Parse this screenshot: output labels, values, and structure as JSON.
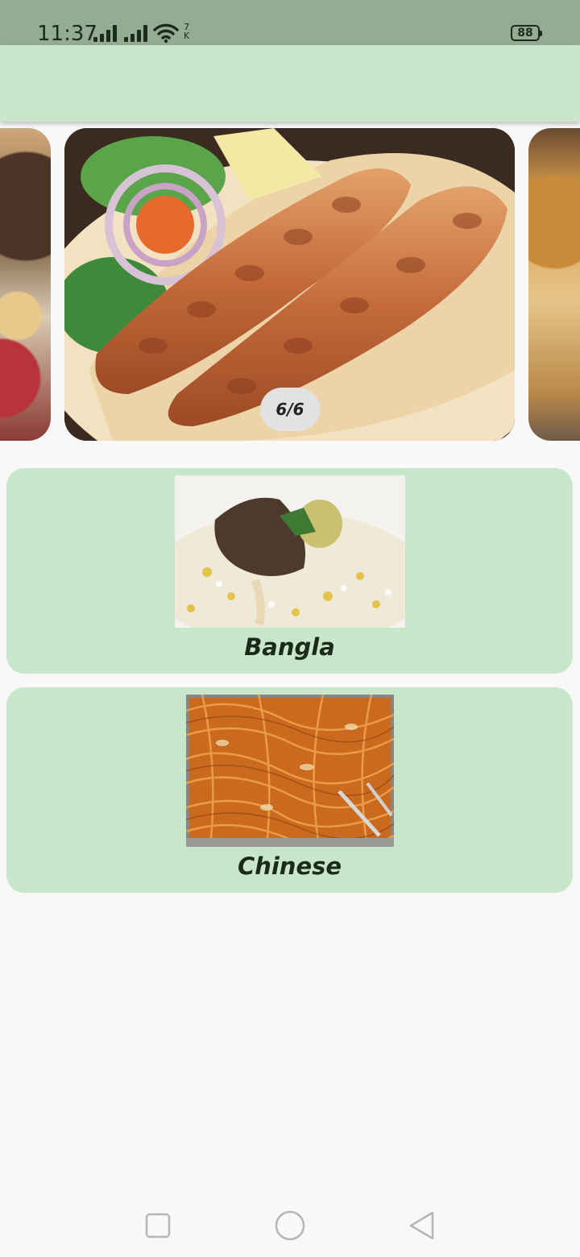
{
  "status_bar": {
    "time": "11:37",
    "net_speed_value": "7",
    "net_speed_unit": "K",
    "battery": "88"
  },
  "carousel": {
    "page_indicator": "6/6",
    "slides": [
      {
        "subject": "meat curry with salad"
      },
      {
        "subject": "seekh kebab on naan"
      },
      {
        "subject": "biryani"
      }
    ]
  },
  "categories": [
    {
      "title": "Bangla",
      "image_subject": "mutton biryani"
    },
    {
      "title": "Chinese",
      "image_subject": "chow mein noodles"
    }
  ],
  "navigation": {
    "recents": "recents-icon",
    "home": "home-icon",
    "back": "back-icon"
  },
  "colors": {
    "status_bar": "#94ab94",
    "app_bar": "#c8e6c9",
    "card": "#c8e6c9",
    "background": "#f8f8f8"
  }
}
